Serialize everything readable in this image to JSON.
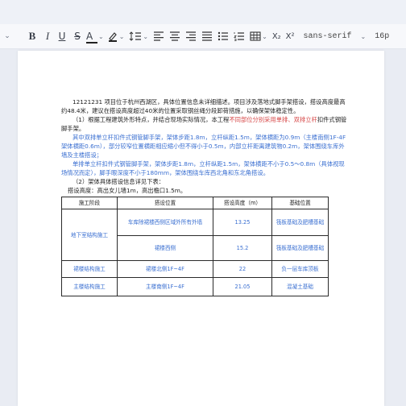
{
  "toolbar": {
    "bold": "B",
    "italic": "I",
    "underline": "U",
    "strike": "S",
    "font_color": "A",
    "subscript": "X₂",
    "superscript": "X²",
    "font_family": "sans-serif",
    "font_size": "16p",
    "icons": [
      "chevron-down-icon",
      "bold-icon",
      "italic-icon",
      "underline-icon",
      "strikethrough-icon",
      "font-color-icon",
      "highlight-icon",
      "line-height-icon",
      "align-left-icon",
      "align-center-icon",
      "align-right-icon",
      "align-justify-icon",
      "bullet-list-icon",
      "numbered-list-icon",
      "table-icon",
      "subscript-icon",
      "superscript-icon"
    ]
  },
  "document": {
    "para1": "12121231 项目位于杭州西湖区，具体位置信息未详细描述。项目涉及落地式脚手架搭设，搭设高度最高约48.4米，建议在搭设高度超过40米的位置采取钢丝绳分段卸荷措施，以确保架体稳定性。",
    "para2_pre": "（1）根据工程建筑外形特点，并结合现场实际情况，本工程",
    "para2_red": "不同部位分别采用单排、双排立杆",
    "para2_post": "扣件式钢管脚手架。",
    "para3": "其中双排单立杆扣件式钢管脚手架，架体步距1.8m，立杆纵距1.5m，架体横距为0.9m（主楼南侧1F-4F架体横距0.6m），部分较窄位置横距相应缩小但不得小于0.5m，内部立杆距离建筑物0.2m，架体围绕车库外墙及主楼搭设；",
    "para4": "单排单立杆扣件式钢管脚手架，架体步距1.8m，立杆纵距1.5m，架体横距不小于0.5～0.8m（具体视现场情况而定），脚手眼深度不小于180mm，架体围绕车库西北角和东北角搭设。",
    "para5": "（2）架体具体搭设信息详见下表：",
    "para6": "搭设高度：高出女儿墙1m，高出檐口1.5m。"
  },
  "table": {
    "headers": [
      "施工阶段",
      "搭设位置",
      "搭设高度（m）",
      "基础位置"
    ],
    "rows": [
      {
        "stage": "地下室结构施工",
        "location": "车库除裙楼西侧区域外所有外墙",
        "height": "13.25",
        "base": "筏板基础及肥槽基础"
      },
      {
        "stage": "",
        "location": "裙楼西侧",
        "height": "15.2",
        "base": "筏板基础及肥槽基础"
      },
      {
        "stage": "裙楼结构施工",
        "location": "裙楼北侧1F~4F",
        "height": "22",
        "base": "负一层车库顶板"
      },
      {
        "stage": "主楼结构施工",
        "location": "主楼南侧1F~4F",
        "height": "21.05",
        "base": "混凝土基础"
      }
    ]
  }
}
